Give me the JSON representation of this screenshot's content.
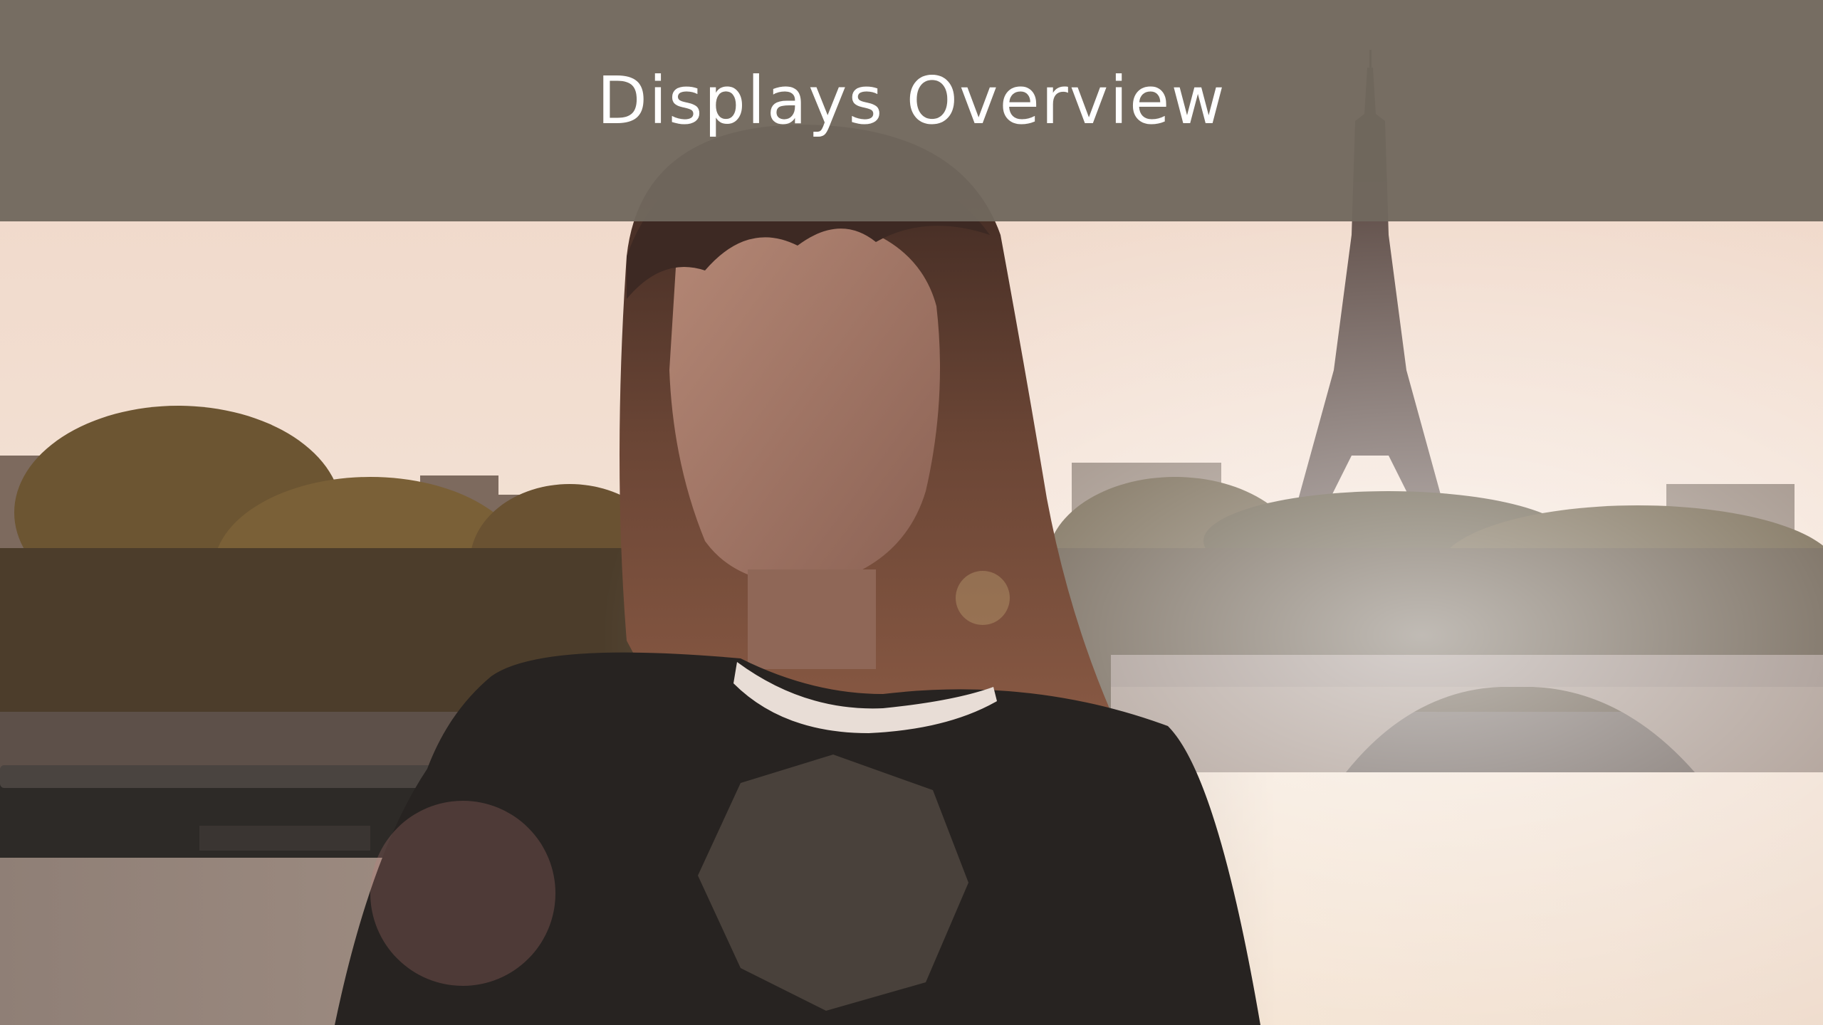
{
  "header": {
    "title": "Displays Overview"
  },
  "colors": {
    "band": "#70685e",
    "title_text": "#ffffff",
    "sky": "#f1dccd",
    "water_glare": "#f6e3cf"
  }
}
